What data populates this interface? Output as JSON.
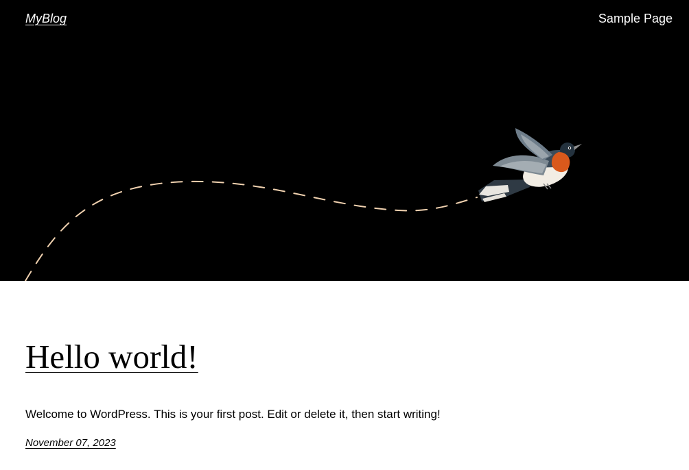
{
  "site": {
    "title": "MyBlog"
  },
  "nav": {
    "items": [
      {
        "label": "Sample Page"
      }
    ]
  },
  "hero": {
    "image": "bird-flight-illustration",
    "background_color": "#000000",
    "path_color": "#f1d2b0"
  },
  "post": {
    "title": "Hello world!",
    "excerpt": "Welcome to WordPress. This is your first post. Edit or delete it, then start writing!",
    "date": "November 07, 2023"
  }
}
